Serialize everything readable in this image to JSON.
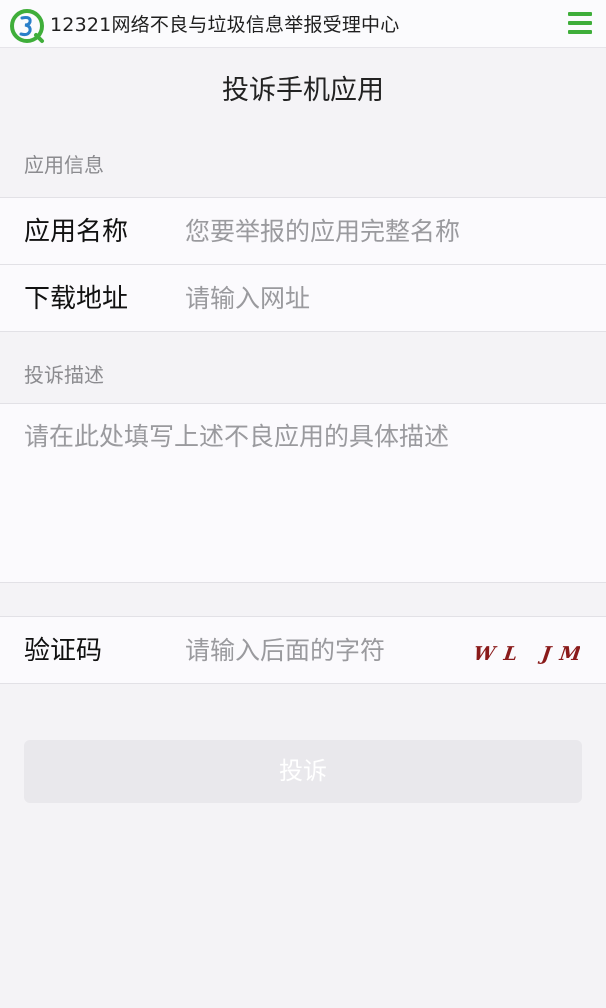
{
  "header": {
    "site_title": "12321网络不良与垃圾信息举报受理中心",
    "logo_icon": "12321-logo-icon",
    "menu_icon": "hamburger-menu-icon",
    "accent_color": "#3fae3a"
  },
  "page": {
    "title": "投诉手机应用"
  },
  "app_info": {
    "section_label": "应用信息",
    "name_label": "应用名称",
    "name_placeholder": "您要举报的应用完整名称",
    "url_label": "下载地址",
    "url_placeholder": "请输入网址"
  },
  "complaint": {
    "section_label": "投诉描述",
    "description_placeholder": "请在此处填写上述不良应用的具体描述"
  },
  "verification": {
    "label": "验证码",
    "placeholder": "请输入后面的字符",
    "captcha_text": "WL JM"
  },
  "actions": {
    "submit_label": "投诉"
  }
}
